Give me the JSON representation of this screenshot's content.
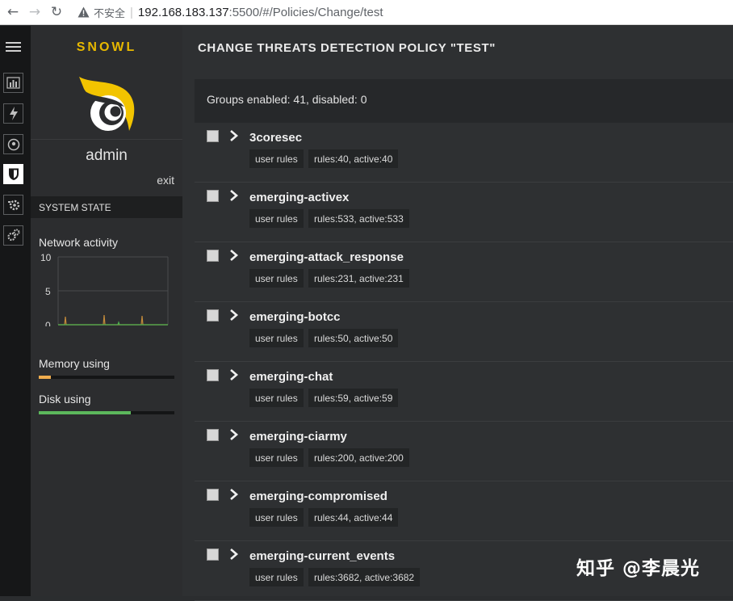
{
  "browser": {
    "insecure_label": "不安全",
    "separator": "|",
    "url_host": "192.168.183.137",
    "url_path": ":5500/#/Policies/Change/test"
  },
  "brand": {
    "name": "SNOWL",
    "accent_color": "#e7b800"
  },
  "user": {
    "name": "admin",
    "exit_label": "exit"
  },
  "strip_icons": [
    "menu-icon",
    "dashboard-icon",
    "events-icon",
    "location-icon",
    "policies-shield-icon",
    "tools-icon",
    "settings-gears-icon"
  ],
  "system_state": {
    "header": "SYSTEM STATE",
    "network_label": "Network activity",
    "network_ticks": [
      "10",
      "5",
      "0"
    ],
    "memory_label": "Memory using",
    "memory_level": 0.09,
    "memory_color": "#f0ad4e",
    "disk_label": "Disk using",
    "disk_level": 0.68,
    "disk_color": "#5cb85c"
  },
  "page": {
    "title": "CHANGE THREATS DETECTION POLICY \"TEST\"",
    "summary": "Groups enabled: 41, disabled: 0"
  },
  "groups": [
    {
      "name": "3coresec",
      "tag": "user rules",
      "stats": "rules:40, active:40"
    },
    {
      "name": "emerging-activex",
      "tag": "user rules",
      "stats": "rules:533, active:533"
    },
    {
      "name": "emerging-attack_response",
      "tag": "user rules",
      "stats": "rules:231, active:231"
    },
    {
      "name": "emerging-botcc",
      "tag": "user rules",
      "stats": "rules:50, active:50"
    },
    {
      "name": "emerging-chat",
      "tag": "user rules",
      "stats": "rules:59, active:59"
    },
    {
      "name": "emerging-ciarmy",
      "tag": "user rules",
      "stats": "rules:200, active:200"
    },
    {
      "name": "emerging-compromised",
      "tag": "user rules",
      "stats": "rules:44, active:44"
    },
    {
      "name": "emerging-current_events",
      "tag": "user rules",
      "stats": "rules:3682, active:3682"
    }
  ],
  "watermark": "知乎 @李晨光"
}
